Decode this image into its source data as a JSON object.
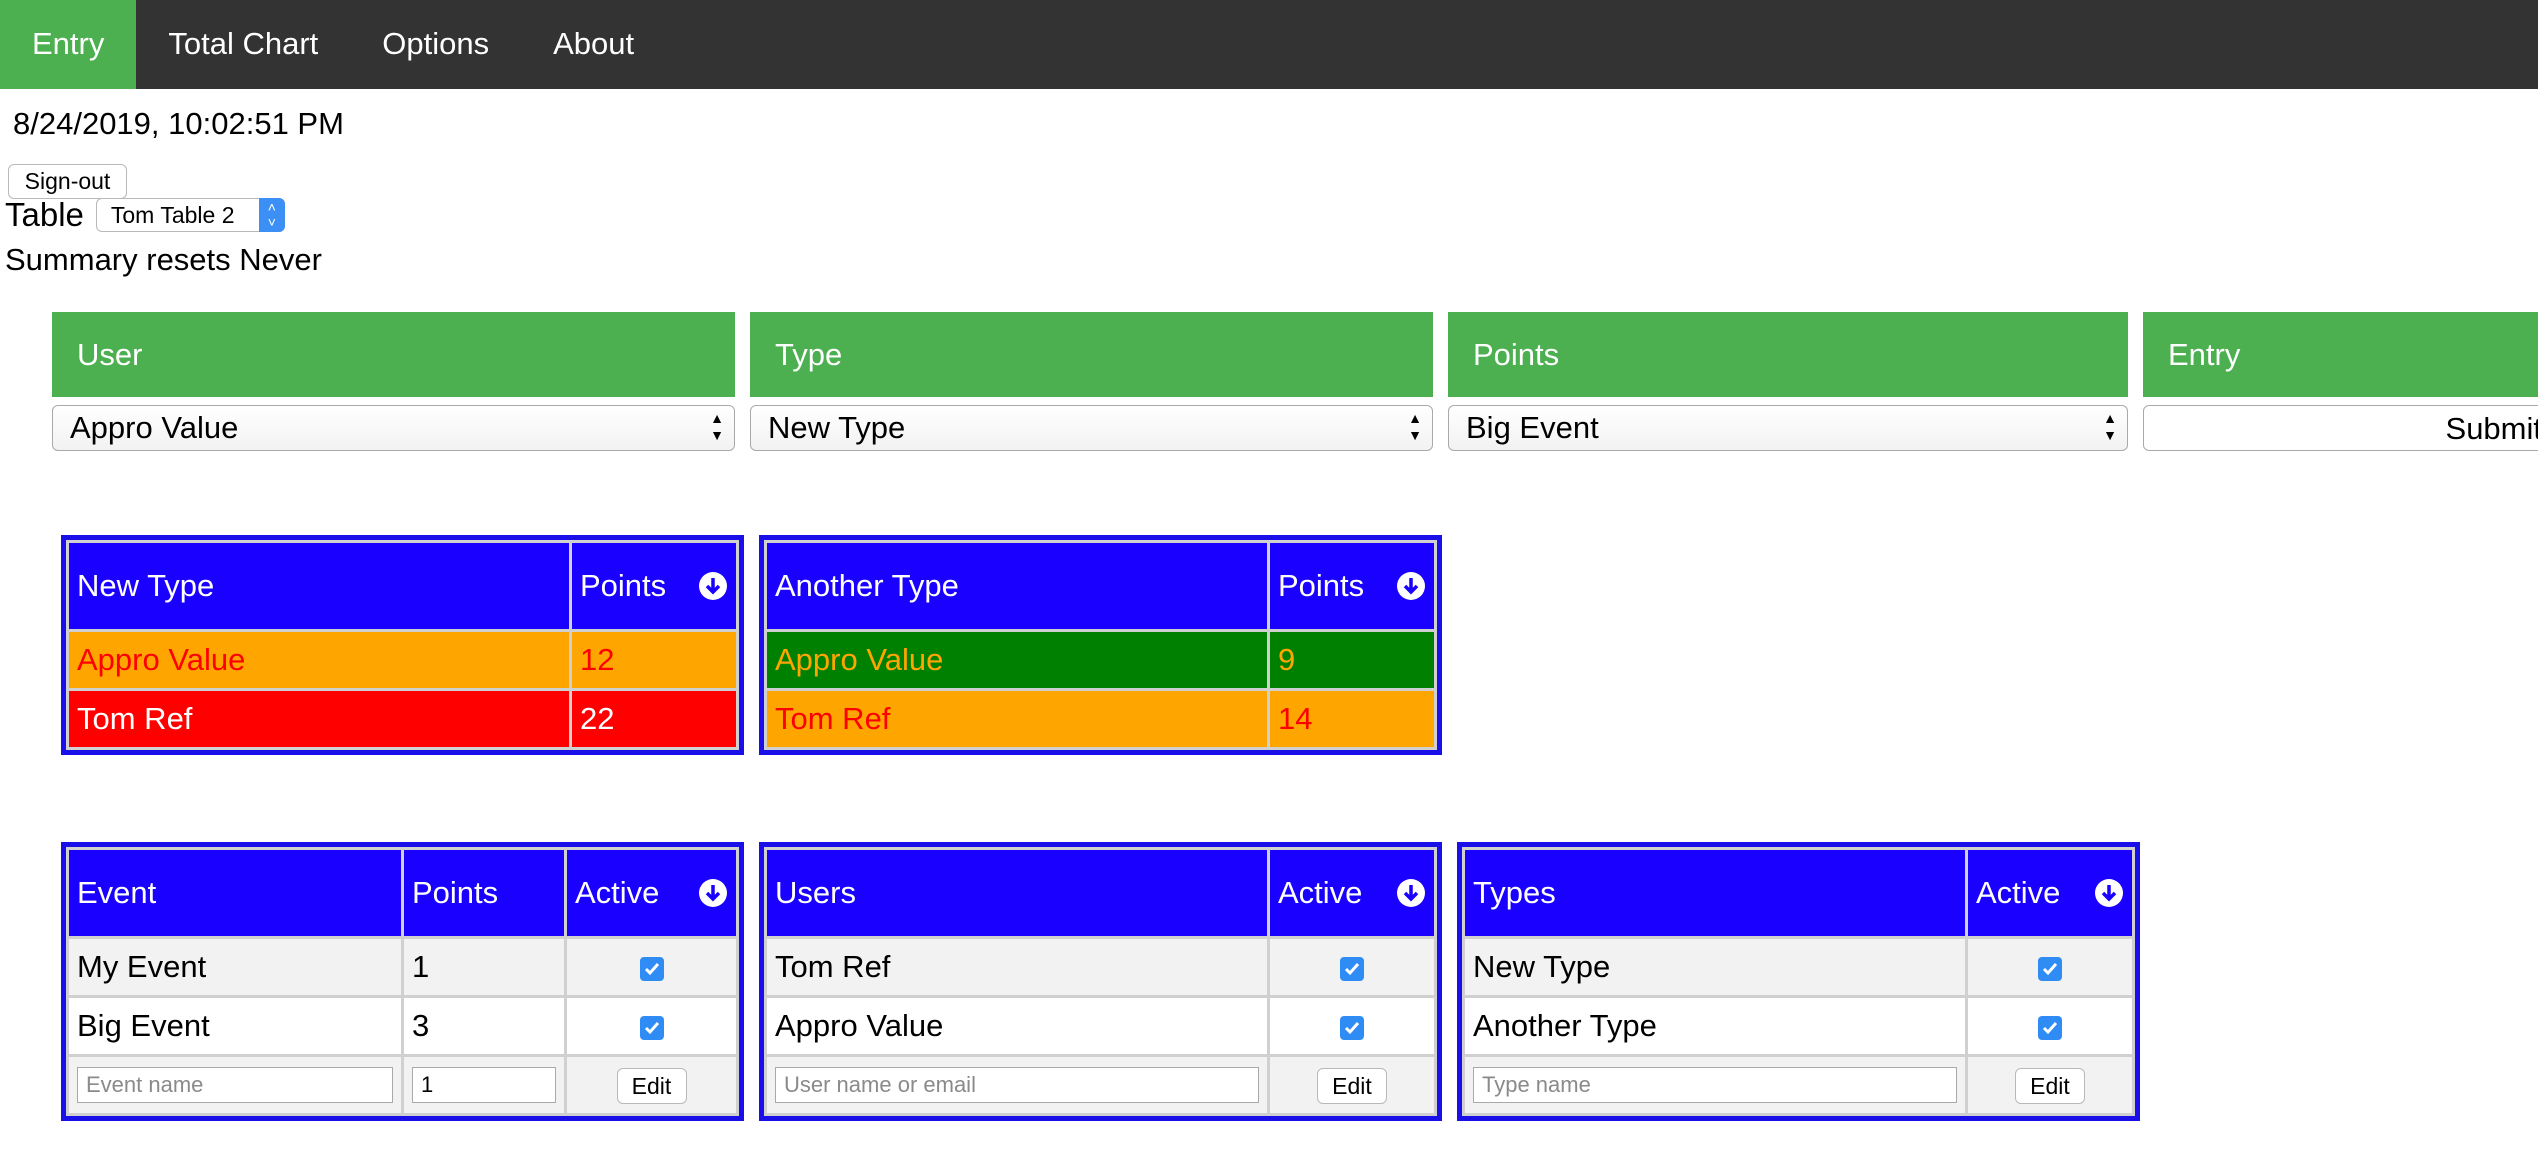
{
  "nav": {
    "items": [
      {
        "label": "Entry",
        "active": true
      },
      {
        "label": "Total Chart",
        "active": false
      },
      {
        "label": "Options",
        "active": false
      },
      {
        "label": "About",
        "active": false
      }
    ]
  },
  "timestamp": "8/24/2019, 10:02:51 PM",
  "signout_label": "Sign-out",
  "table_picker": {
    "label": "Table",
    "selected": "Tom Table 2"
  },
  "summary_resets": "Summary resets Never",
  "entry_form": {
    "headers": {
      "user": "User",
      "type": "Type",
      "points": "Points",
      "entry": "Entry"
    },
    "user_selected": "Appro Value",
    "type_selected": "New Type",
    "points_selected": "Big Event",
    "submit_label": "Submit"
  },
  "summary_tables": [
    {
      "type_header": "New Type",
      "points_header": "Points",
      "rows": [
        {
          "name": "Appro Value",
          "points": "12",
          "bg": "#ffa500",
          "fg": "#ff0000"
        },
        {
          "name": "Tom Ref",
          "points": "22",
          "bg": "#ff0000",
          "fg": "#ffffff"
        }
      ]
    },
    {
      "type_header": "Another Type",
      "points_header": "Points",
      "rows": [
        {
          "name": "Appro Value",
          "points": "9",
          "bg": "#008000",
          "fg": "#ffa500"
        },
        {
          "name": "Tom Ref",
          "points": "14",
          "bg": "#ffa500",
          "fg": "#ff0000"
        }
      ]
    }
  ],
  "events_table": {
    "headers": {
      "event": "Event",
      "points": "Points",
      "active": "Active"
    },
    "rows": [
      {
        "name": "My Event",
        "points": "1",
        "active": true
      },
      {
        "name": "Big Event",
        "points": "3",
        "active": true
      }
    ],
    "name_placeholder": "Event name",
    "points_value": "1",
    "edit_label": "Edit"
  },
  "users_table": {
    "headers": {
      "users": "Users",
      "active": "Active"
    },
    "rows": [
      {
        "name": "Tom Ref",
        "active": true
      },
      {
        "name": "Appro Value",
        "active": true
      }
    ],
    "name_placeholder": "User name or email",
    "edit_label": "Edit"
  },
  "types_table": {
    "headers": {
      "types": "Types",
      "active": "Active"
    },
    "rows": [
      {
        "name": "New Type",
        "active": true
      },
      {
        "name": "Another Type",
        "active": true
      }
    ],
    "name_placeholder": "Type name",
    "edit_label": "Edit"
  },
  "colors": {
    "nav_bg": "#333333",
    "accent_green": "#4CAF50",
    "table_blue": "#1a00ff",
    "checkbox_blue": "#2f8cf4"
  }
}
